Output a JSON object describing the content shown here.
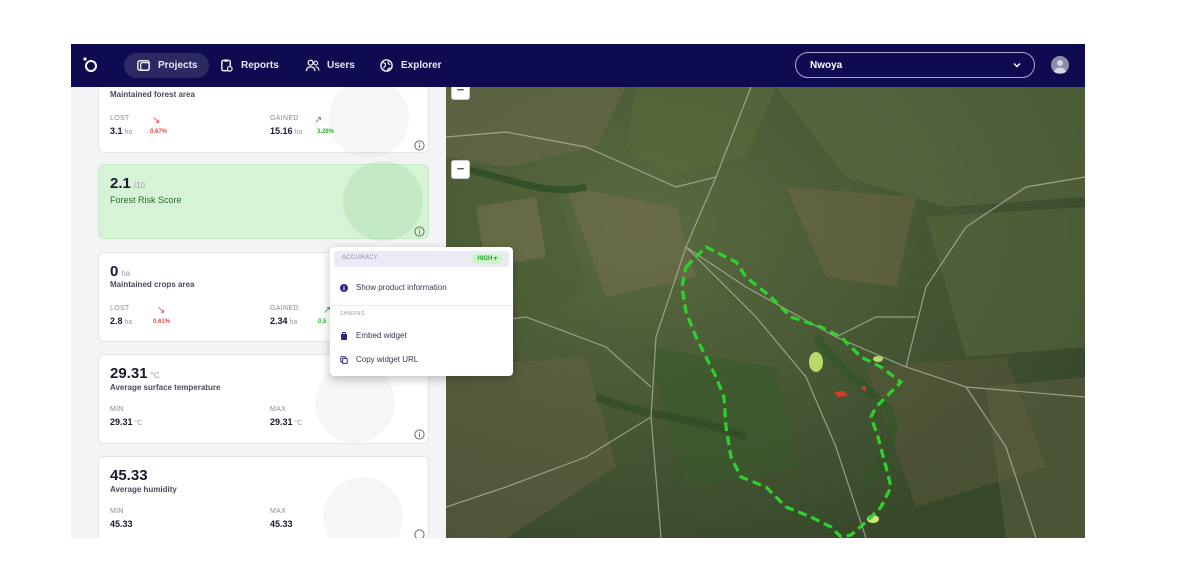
{
  "nav": {
    "items": [
      {
        "label": "Projects",
        "icon": "folder-icon",
        "active": true
      },
      {
        "label": "Reports",
        "icon": "clipboard-icon",
        "active": false
      },
      {
        "label": "Users",
        "icon": "users-icon",
        "active": false
      },
      {
        "label": "Explorer",
        "icon": "globe-icon",
        "active": false
      }
    ],
    "project_select": {
      "value": "Nwoya"
    }
  },
  "cards": {
    "forest": {
      "subtitle": "Maintained forest area",
      "lost_label": "LOST",
      "lost_value": "3.1",
      "lost_unit": "ha",
      "lost_pct": "0.67%",
      "gained_label": "GAINED",
      "gained_value": "15.16",
      "gained_unit": "ha",
      "gained_pct": "3.28%"
    },
    "risk": {
      "value": "2.1",
      "unit": "/10",
      "label": "Forest Risk Score"
    },
    "crops": {
      "value": "0",
      "unit": "ha",
      "subtitle": "Maintained crops area",
      "lost_label": "LOST",
      "lost_value": "2.8",
      "lost_unit": "ha",
      "lost_pct": "0.61%",
      "gained_label": "GAINED",
      "gained_value": "2.34",
      "gained_unit": "ha",
      "gained_pct": "0.5"
    },
    "temperature": {
      "value": "29.31",
      "unit": "°C",
      "subtitle": "Average surface temperature",
      "min_label": "MIN",
      "min_value": "29.31",
      "min_unit": "°C",
      "max_label": "MAX",
      "max_value": "29.31",
      "max_unit": "°C"
    },
    "humidity": {
      "value": "45.33",
      "subtitle": "Average humidity",
      "min_label": "MIN",
      "min_value": "45.33",
      "max_label": "MAX",
      "max_value": "45.33"
    }
  },
  "popup": {
    "accuracy_label": "ACCURACY",
    "accuracy_badge": "HIGH",
    "show_info": "Show product information",
    "sharing_label": "SHARING",
    "embed": "Embed widget",
    "copy_url": "Copy widget URL"
  },
  "map": {
    "zoom_out": "−"
  },
  "colors": {
    "nav_bg": "#0f0b50",
    "accent_green": "#2fd12f",
    "risk_card": "#d7f3d6"
  }
}
